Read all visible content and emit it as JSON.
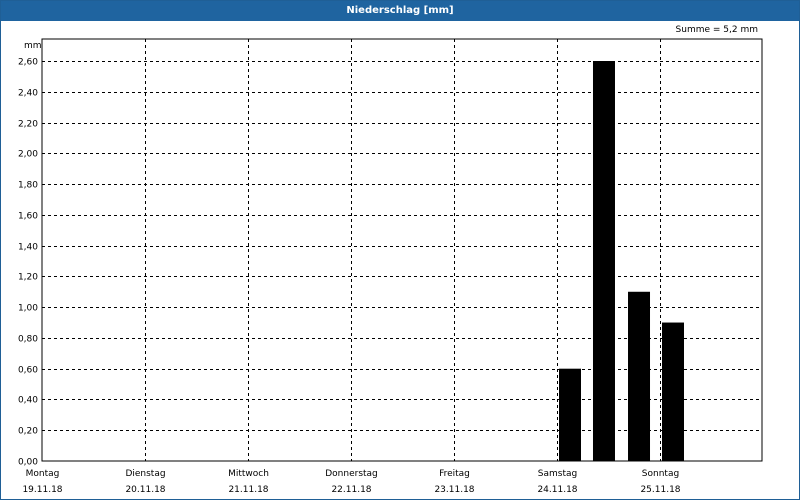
{
  "window": {
    "title": "Niederschlag [mm]"
  },
  "summary": {
    "text": "Summe = 5,2 mm"
  },
  "chart_data": {
    "type": "bar",
    "title": "Niederschlag [mm]",
    "ylabel": "mm",
    "ylim": [
      0,
      2.6
    ],
    "yticks": [
      "0,00",
      "0,20",
      "0,40",
      "0,60",
      "0,80",
      "1,00",
      "1,20",
      "1,40",
      "1,60",
      "1,80",
      "2,00",
      "2,20",
      "2,40",
      "2,60"
    ],
    "days": [
      {
        "name": "Montag",
        "date": "19.11.18"
      },
      {
        "name": "Dienstag",
        "date": "20.11.18"
      },
      {
        "name": "Mittwoch",
        "date": "21.11.18"
      },
      {
        "name": "Donnerstag",
        "date": "22.11.18"
      },
      {
        "name": "Freitag",
        "date": "23.11.18"
      },
      {
        "name": "Samstag",
        "date": "24.11.18"
      },
      {
        "name": "Sonntag",
        "date": "25.11.18"
      }
    ],
    "bars": [
      {
        "day": 5.0,
        "value": 0.6
      },
      {
        "day": 5.33,
        "value": 2.6
      },
      {
        "day": 5.67,
        "value": 1.1
      },
      {
        "day": 6.0,
        "value": 0.9
      }
    ],
    "bar_color": "#000000",
    "grid": true,
    "grid_style": "dashed"
  }
}
